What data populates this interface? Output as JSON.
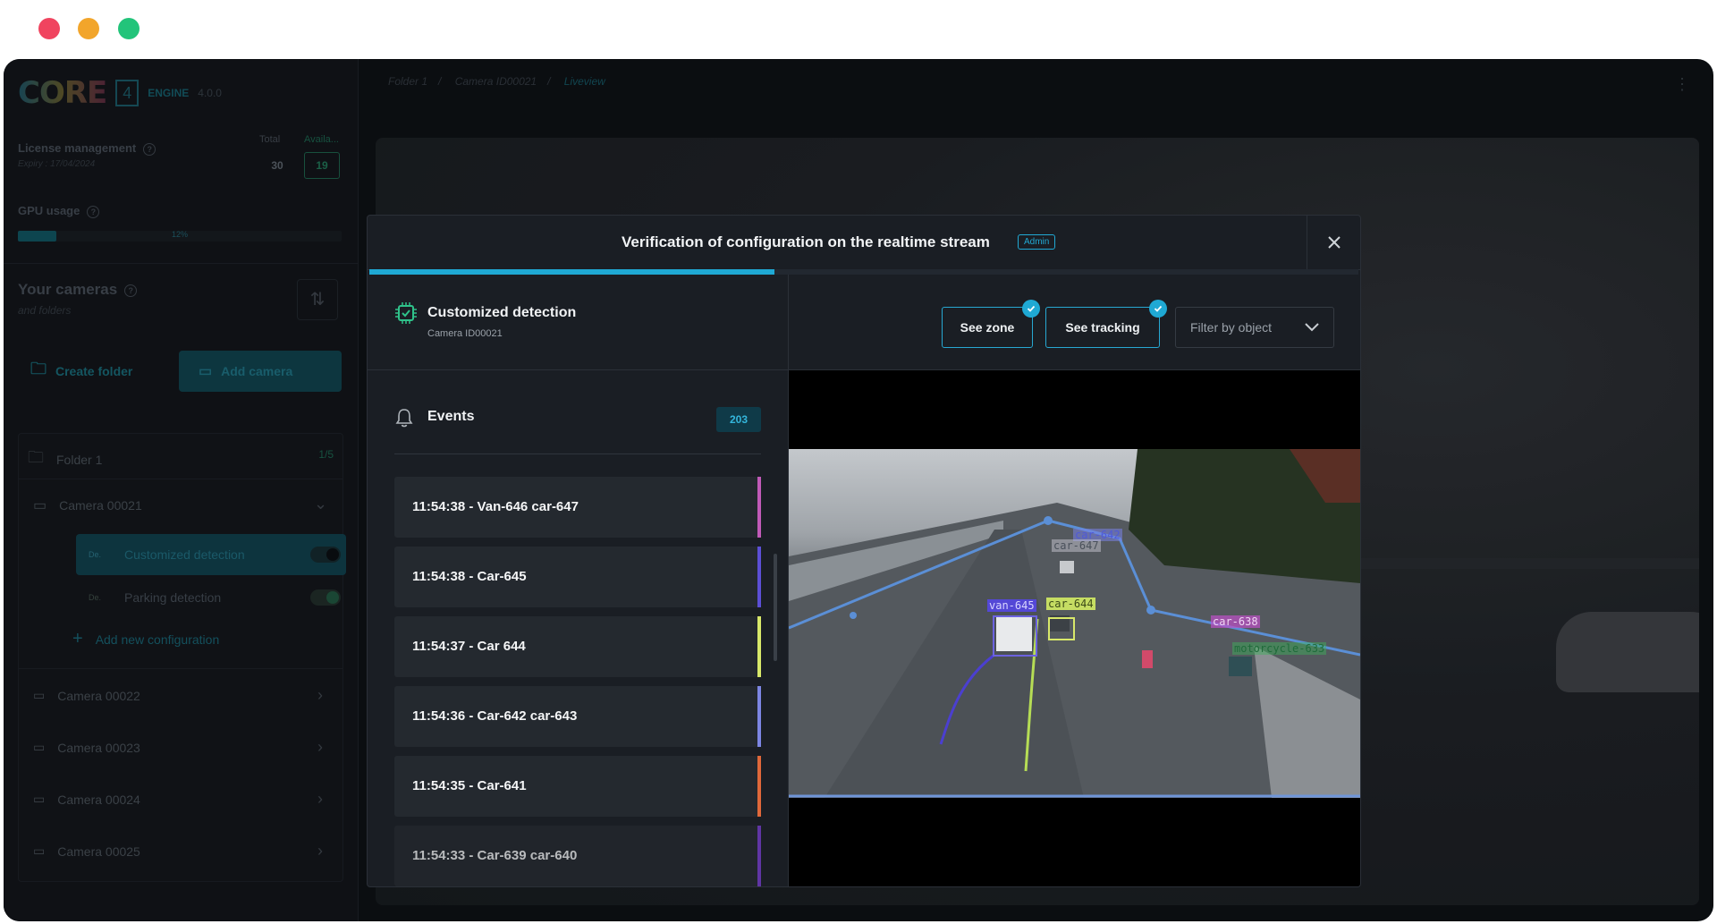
{
  "window": {
    "dots": [
      "#f0445f",
      "#f2a52b",
      "#22c47a"
    ]
  },
  "sidebar": {
    "logo": {
      "core": "CORE",
      "num": "4",
      "engine": "ENGINE",
      "version": "4.0.0"
    },
    "license": {
      "title": "License management",
      "expiry": "Expiry : 17/04/2024",
      "total_label": "Total",
      "avail_label": "Availa...",
      "total": "30",
      "available": "19"
    },
    "gpu": {
      "title": "GPU usage",
      "percent": "12%",
      "fill": 0.12
    },
    "cameras": {
      "title": "Your cameras",
      "sub": "and folders"
    },
    "create_folder": "Create folder",
    "add_camera": "Add camera",
    "folder": {
      "name": "Folder 1",
      "count": "1/5"
    },
    "camera_open": "Camera 00021",
    "configs": [
      {
        "chip": "De.",
        "label": "Customized detection"
      },
      {
        "chip": "De.",
        "label": "Parking detection"
      }
    ],
    "add_config": "Add new configuration",
    "cameras_other": [
      "Camera 00022",
      "Camera 00023",
      "Camera 00024",
      "Camera 00025"
    ]
  },
  "breadcrumb": {
    "items": [
      "Folder 1",
      "Camera ID00021",
      "Liveview"
    ]
  },
  "modal": {
    "title": "Verification of configuration on the realtime stream",
    "badge": "Admin",
    "progress": 0.41,
    "detection": {
      "title": "Customized detection",
      "camera": "Camera ID00021"
    },
    "events": {
      "title": "Events",
      "count": "203"
    },
    "event_items": [
      {
        "label": "11:54:38 - Van-646 car-647",
        "color": "#c15ab8"
      },
      {
        "label": "11:54:38 - Car-645",
        "color": "#5c4fd6"
      },
      {
        "label": "11:54:37 - Car 644",
        "color": "#d8e86a"
      },
      {
        "label": "11:54:36 - Car-642 car-643",
        "color": "#7d86e3"
      },
      {
        "label": "11:54:35 - Car-641",
        "color": "#e0683a"
      },
      {
        "label": "11:54:33 - Car-639 car-640",
        "color": "#7b3fd6"
      }
    ],
    "toolbar": {
      "see_zone": "See zone",
      "see_tracking": "See tracking",
      "filter": "Filter by object"
    },
    "video_labels": {
      "car642": "car-642",
      "car647": "car-647",
      "van645": "van-645",
      "car644": "car-644",
      "car638": "car-638",
      "motorcycle": "motorcycle-633"
    }
  }
}
